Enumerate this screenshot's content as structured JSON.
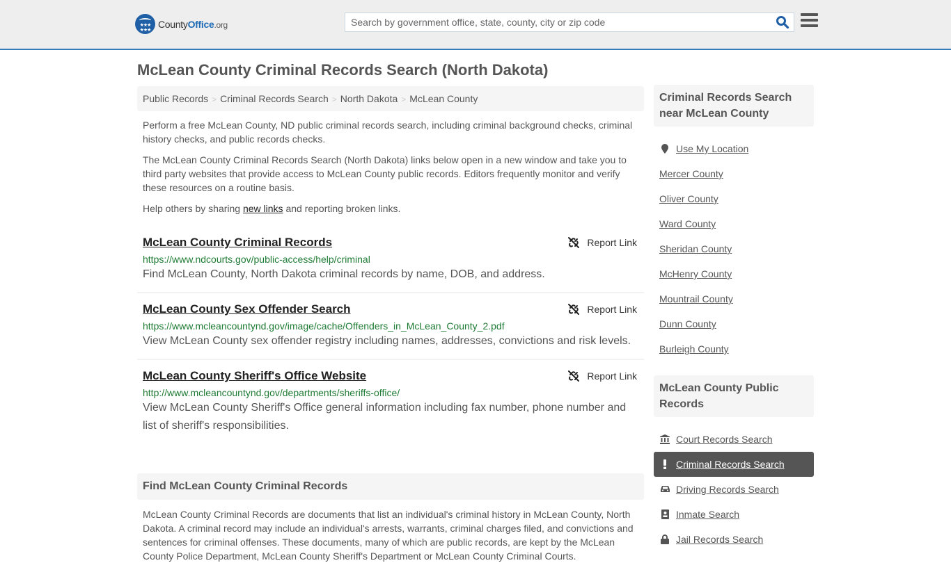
{
  "header": {
    "logo": {
      "county": "County",
      "office": "Office",
      "org": ".org"
    },
    "search_placeholder": "Search by government office, state, county, city or zip code",
    "search_icon": "search-icon",
    "menu_icon": "hamburger-menu-icon"
  },
  "page_title": "McLean County Criminal Records Search (North Dakota)",
  "breadcrumb": [
    "Public Records",
    "Criminal Records Search",
    "North Dakota",
    "McLean County"
  ],
  "intro": {
    "p1": "Perform a free McLean County, ND public criminal records search, including criminal background checks, criminal history checks, and public records checks.",
    "p2": "The McLean County Criminal Records Search (North Dakota) links below open in a new window and take you to third party websites that provide access to McLean County public records. Editors frequently monitor and verify these resources on a routine basis.",
    "p3_before": "Help others by sharing ",
    "p3_link": "new links",
    "p3_after": " and reporting broken links."
  },
  "records": [
    {
      "title": "McLean County Criminal Records",
      "url": "https://www.ndcourts.gov/public-access/help/criminal",
      "desc": "Find McLean County, North Dakota criminal records by name, DOB, and address.",
      "report": "Report Link"
    },
    {
      "title": "McLean County Sex Offender Search",
      "url": "https://www.mcleancountynd.gov/image/cache/Offenders_in_McLean_County_2.pdf",
      "desc": "View McLean County sex offender registry including names, addresses, convictions and risk levels.",
      "report": "Report Link"
    },
    {
      "title": "McLean County Sheriff's Office Website",
      "url": "http://www.mcleancountynd.gov/departments/sheriffs-office/",
      "desc": "View McLean County Sheriff's Office general information including fax number, phone number and list of sheriff's responsibilities.",
      "report": "Report Link"
    }
  ],
  "find_section": {
    "heading": "Find McLean County Criminal Records",
    "text": "McLean County Criminal Records are documents that list an individual's criminal history in McLean County, North Dakota. A criminal record may include an individual's arrests, warrants, criminal charges filed, and convictions and sentences for criminal offenses. These documents, many of which are public records, are kept by the McLean County Police Department, McLean County Sheriff's Department or McLean County Criminal Courts."
  },
  "sidebar": {
    "nearby_heading": "Criminal Records Search near McLean County",
    "use_location": "Use My Location",
    "nearby": [
      "Mercer County",
      "Oliver County",
      "Ward County",
      "Sheridan County",
      "McHenry County",
      "Mountrail County",
      "Dunn County",
      "Burleigh County"
    ],
    "public_heading": "McLean County Public Records",
    "public_links": [
      {
        "label": "Court Records Search",
        "icon": "courthouse-icon",
        "active": false
      },
      {
        "label": "Criminal Records Search",
        "icon": "exclamation-icon",
        "active": true
      },
      {
        "label": "Driving Records Search",
        "icon": "car-icon",
        "active": false
      },
      {
        "label": "Inmate Search",
        "icon": "id-badge-icon",
        "active": false
      },
      {
        "label": "Jail Records Search",
        "icon": "lock-icon",
        "active": false
      }
    ]
  },
  "colors": {
    "accent": "#337ab7",
    "url_green": "#1e7b34",
    "active_bg": "#555555"
  }
}
